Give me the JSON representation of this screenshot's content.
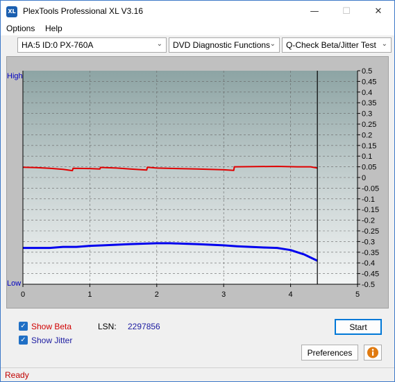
{
  "window": {
    "app_icon_text": "XL",
    "title": "PlexTools Professional XL V3.16"
  },
  "menu": {
    "options": "Options",
    "help": "Help"
  },
  "toolbar": {
    "drive": "HA:5 ID:0  PX-760A",
    "function": "DVD Diagnostic Functions",
    "test": "Q-Check Beta/Jitter Test"
  },
  "chart_data": {
    "type": "line",
    "high_label": "High",
    "low_label": "Low",
    "xlim": [
      0,
      5
    ],
    "ylim": [
      -0.5,
      0.5
    ],
    "x_ticks": [
      "0",
      "1",
      "2",
      "3",
      "4",
      "5"
    ],
    "y_ticks": [
      "0.5",
      "0.45",
      "0.4",
      "0.35",
      "0.3",
      "0.25",
      "0.2",
      "0.15",
      "0.1",
      "0.05",
      "0",
      "-0.05",
      "-0.1",
      "-0.15",
      "-0.2",
      "-0.25",
      "-0.3",
      "-0.35",
      "-0.4",
      "-0.45",
      "-0.5"
    ],
    "end_marker_x": 4.4,
    "grid": true,
    "series": [
      {
        "color": "#e00000",
        "x": [
          0,
          0.2,
          0.4,
          0.6,
          0.74,
          0.75,
          1.0,
          1.15,
          1.16,
          1.4,
          1.6,
          1.85,
          1.86,
          2.0,
          2.3,
          2.6,
          3.0,
          3.15,
          3.16,
          3.5,
          3.8,
          4.1,
          4.3,
          4.4
        ],
        "y": [
          0.048,
          0.046,
          0.043,
          0.038,
          0.032,
          0.043,
          0.042,
          0.04,
          0.047,
          0.044,
          0.04,
          0.035,
          0.048,
          0.044,
          0.042,
          0.04,
          0.036,
          0.033,
          0.05,
          0.051,
          0.052,
          0.05,
          0.05,
          0.044
        ]
      },
      {
        "color": "#0000ee",
        "x": [
          0,
          0.2,
          0.4,
          0.6,
          0.8,
          1.0,
          1.2,
          1.4,
          1.6,
          1.8,
          2.0,
          2.2,
          2.4,
          2.6,
          2.8,
          3.0,
          3.2,
          3.4,
          3.6,
          3.8,
          3.9,
          4.0,
          4.1,
          4.2,
          4.3,
          4.4
        ],
        "y": [
          -0.33,
          -0.33,
          -0.33,
          -0.325,
          -0.325,
          -0.32,
          -0.318,
          -0.315,
          -0.312,
          -0.31,
          -0.308,
          -0.308,
          -0.31,
          -0.312,
          -0.315,
          -0.318,
          -0.322,
          -0.325,
          -0.328,
          -0.33,
          -0.335,
          -0.34,
          -0.35,
          -0.36,
          -0.375,
          -0.39
        ]
      }
    ]
  },
  "controls": {
    "show_beta": "Show Beta",
    "show_jitter": "Show Jitter",
    "lsn_label": "LSN:",
    "lsn_value": "2297856",
    "start": "Start",
    "preferences": "Preferences"
  },
  "status": {
    "text": "Ready"
  }
}
